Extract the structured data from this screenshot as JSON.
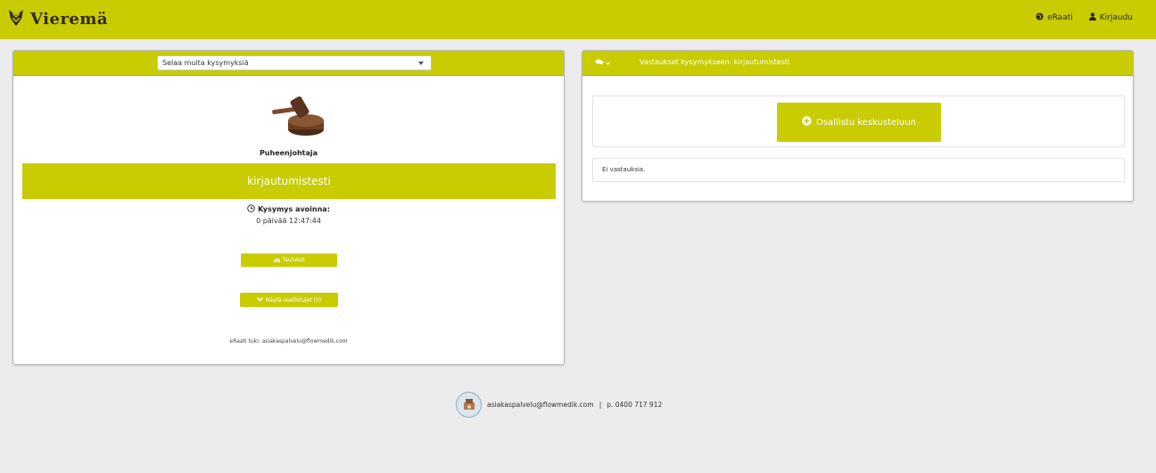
{
  "header": {
    "brand": "Vieremä",
    "nav": [
      {
        "label": "eRaati",
        "icon": "globe-icon"
      },
      {
        "label": "Kirjaudu",
        "icon": "user-icon"
      }
    ]
  },
  "left_panel": {
    "select": {
      "value": "Selaa muita kysymyksiä"
    },
    "role": "Puheenjohtaja",
    "question_title": "kirjautumistesti",
    "open_label": "Kysymys avoinna:",
    "open_time": "0 päivää 12:47:44",
    "tables_button": "Taulukot",
    "participants_button": "Näytä osallistujat (0)",
    "support": "eRaati tuki: asiakaspalvelu@flowmedik.com"
  },
  "right_panel": {
    "title": "Vastaukset kysymykseen: kirjautumistesti",
    "join_button": "Osallistu keskusteluun",
    "no_answers": "Ei vastauksia."
  },
  "footer": {
    "email": "asiakaspalvelu@flowmedik.com",
    "separator": "|",
    "phone": "p. 0400 717 912"
  },
  "colors": {
    "accent": "#c8cc00",
    "background": "#ececec"
  }
}
